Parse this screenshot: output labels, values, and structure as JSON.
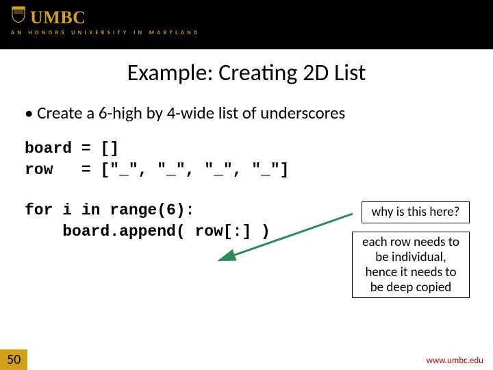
{
  "header": {
    "logo_text": "UMBC",
    "tagline": "AN HONORS UNIVERSITY IN MARYLAND"
  },
  "slide": {
    "title": "Example: Creating 2D List",
    "bullet": "Create a 6-high by 4-wide list of underscores",
    "code_line1": "board = []",
    "code_line2": "row   = [\"_\", \"_\", \"_\", \"_\"]",
    "code_line3": "for i in range(6):",
    "code_line4": "    board.append( row[:] )",
    "annotation1": "why is this here?",
    "annotation2": "each row needs to be individual, hence it needs to be deep copied"
  },
  "footer": {
    "page_number": "50",
    "url": "www.umbc.edu"
  },
  "colors": {
    "gold": "#d4a017",
    "arrow_green": "#2e8b57",
    "url_red": "#c00000"
  }
}
